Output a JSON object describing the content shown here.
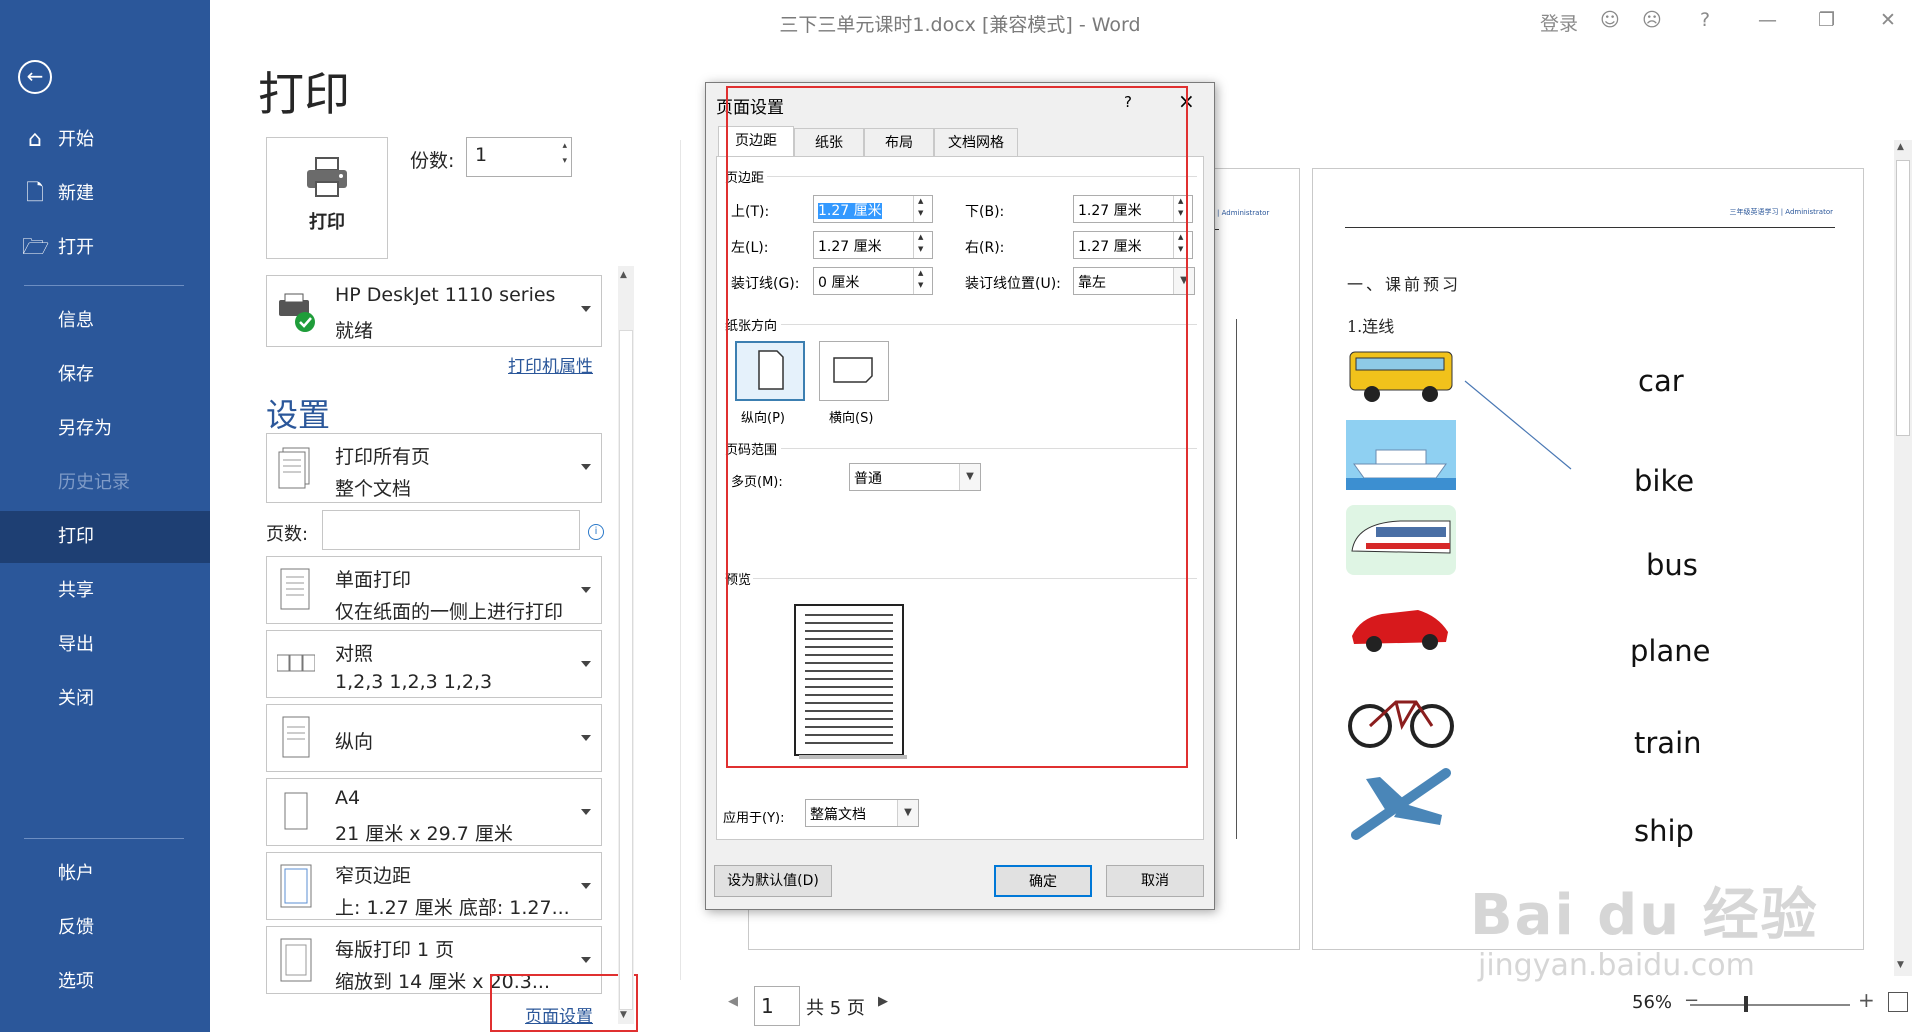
{
  "window": {
    "title": "三下三单元课时1.docx [兼容模式] - Word",
    "login_label": "登录",
    "help_label": "?"
  },
  "nav": {
    "back_icon": "arrow-left-icon",
    "items": [
      {
        "label": "开始",
        "icon": "home-icon"
      },
      {
        "label": "新建",
        "icon": "new-doc-icon"
      },
      {
        "label": "打开",
        "icon": "open-folder-icon"
      },
      {
        "label": "信息"
      },
      {
        "label": "保存"
      },
      {
        "label": "另存为"
      },
      {
        "label": "历史记录",
        "disabled": true
      },
      {
        "label": "打印",
        "active": true
      },
      {
        "label": "共享"
      },
      {
        "label": "导出"
      },
      {
        "label": "关闭"
      },
      {
        "label": "帐户"
      },
      {
        "label": "反馈"
      },
      {
        "label": "选项"
      }
    ]
  },
  "print": {
    "heading": "打印",
    "print_button_label": "打印",
    "copies_label": "份数:",
    "copies_value": "1",
    "printer_name": "HP DeskJet 1110 series",
    "printer_status": "就绪",
    "printer_properties_link": "打印机属性",
    "settings_heading": "设置",
    "pages_label": "页数:",
    "pages_value": "",
    "settings": [
      {
        "line1": "打印所有页",
        "line2": "整个文档"
      },
      {
        "line1": "单面打印",
        "line2": "仅在纸面的一侧上进行打印"
      },
      {
        "line1": "对照",
        "line2": "1,2,3    1,2,3    1,2,3"
      },
      {
        "line1": "纵向",
        "line2": ""
      },
      {
        "line1": "A4",
        "line2": "21 厘米 x 29.7 厘米"
      },
      {
        "line1": "窄页边距",
        "line2": "上: 1.27 厘米 底部: 1.27..."
      },
      {
        "line1": "每版打印 1 页",
        "line2": "缩放到 14 厘米 x 20.3..."
      }
    ],
    "page_setup_link": "页面设置"
  },
  "preview": {
    "page_header_text": "三年级英语学习 | Administrator",
    "section_title": "一、课前预习",
    "subsection": "1.连线",
    "words": [
      "car",
      "bike",
      "bus",
      "plane",
      "train",
      "ship"
    ],
    "current_page": "1",
    "total_pages_label": "共 5 页",
    "zoom_label": "56%",
    "zoom_minus": "−",
    "zoom_plus": "+"
  },
  "dialog": {
    "title": "页面设置",
    "help": "?",
    "close": "×",
    "tabs": [
      "页边距",
      "纸张",
      "布局",
      "文档网格"
    ],
    "active_tab": 0,
    "margins_group": "页边距",
    "top_label": "上(T):",
    "top_value": "1.27 厘米",
    "bottom_label": "下(B):",
    "bottom_value": "1.27 厘米",
    "left_label": "左(L):",
    "left_value": "1.27 厘米",
    "right_label": "右(R):",
    "right_value": "1.27 厘米",
    "gutter_label": "装订线(G):",
    "gutter_value": "0 厘米",
    "gutter_pos_label": "装订线位置(U):",
    "gutter_pos_value": "靠左",
    "orientation_group": "纸张方向",
    "portrait_label": "纵向(P)",
    "landscape_label": "横向(S)",
    "pages_group": "页码范围",
    "multiple_pages_label": "多页(M):",
    "multiple_pages_value": "普通",
    "preview_group": "预览",
    "apply_to_label": "应用于(Y):",
    "apply_to_value": "整篇文档",
    "set_default_button": "设为默认值(D)",
    "ok_button": "确定",
    "cancel_button": "取消"
  },
  "watermark": {
    "brand": "Bai du 经验",
    "url": "jingyan.baidu.com"
  },
  "colors": {
    "nav_bg": "#2b579a",
    "nav_active": "#1e3f73",
    "accent": "#2b579a",
    "highlight_box": "#e03030"
  }
}
